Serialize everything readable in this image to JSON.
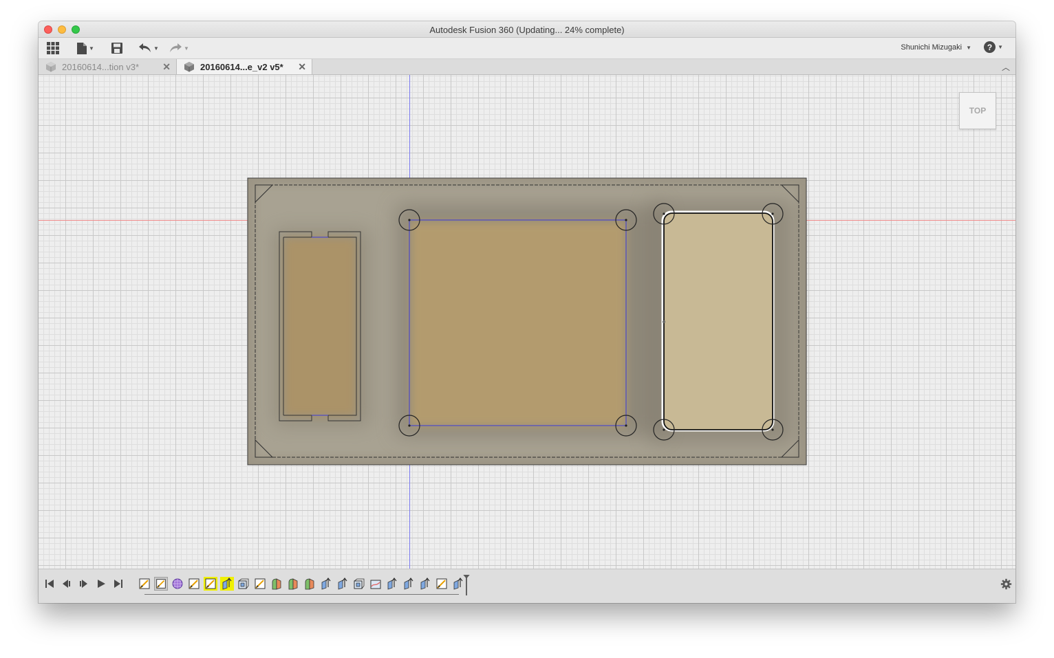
{
  "window": {
    "title": "Autodesk Fusion 360  (Updating... 24% complete)",
    "progress_percent": 24
  },
  "toolbar": {
    "icons": [
      "grid-apps-icon",
      "file-icon",
      "save-icon",
      "undo-icon",
      "redo-icon"
    ],
    "user_name": "Shunichi Mizugaki",
    "user_caret": "▼",
    "help_label": "?",
    "help_caret": "▼"
  },
  "tabs": [
    {
      "label": "20160614...tion v3*",
      "active": false,
      "close": "✕"
    },
    {
      "label": "20160614...e_v2 v5*",
      "active": true,
      "close": "✕"
    }
  ],
  "tabbar": {
    "collapse_glyph": "︿"
  },
  "viewport": {
    "viewcube_label": "TOP",
    "colors": {
      "grid_major": "#c8c8c8",
      "grid_minor": "#dedede",
      "axis_x": "#f08c8c",
      "axis_y": "#7b7bf0",
      "plate": "#9c9585",
      "pocket_center": "#b39b6e",
      "pocket_left": "#ab9368",
      "pocket_right": "#c8b995",
      "sketch_line": "#3a3ad8"
    }
  },
  "timeline": {
    "playback_icons": [
      "skip-to-start-icon",
      "step-back-icon",
      "step-forward-icon",
      "play-icon",
      "skip-to-end-icon"
    ],
    "features": [
      {
        "icon": "sketch-feature-icon",
        "state": "normal"
      },
      {
        "icon": "sketch-feature-icon",
        "state": "selected"
      },
      {
        "icon": "form-feature-icon",
        "state": "normal"
      },
      {
        "icon": "sketch-feature-icon",
        "state": "normal"
      },
      {
        "icon": "sketch-feature-icon",
        "state": "highlighted"
      },
      {
        "icon": "extrude-feature-icon",
        "state": "highlighted"
      },
      {
        "icon": "shell-feature-icon",
        "state": "normal"
      },
      {
        "icon": "sketch-feature-icon",
        "state": "normal"
      },
      {
        "icon": "fillet-feature-icon",
        "state": "normal"
      },
      {
        "icon": "fillet-feature-icon",
        "state": "normal"
      },
      {
        "icon": "fillet-feature-icon",
        "state": "normal"
      },
      {
        "icon": "extrude-feature-icon",
        "state": "normal"
      },
      {
        "icon": "extrude-feature-icon",
        "state": "normal"
      },
      {
        "icon": "shell-feature-icon",
        "state": "normal"
      },
      {
        "icon": "patch-feature-icon",
        "state": "normal"
      },
      {
        "icon": "extrude-feature-icon",
        "state": "normal"
      },
      {
        "icon": "extrude-feature-icon",
        "state": "normal"
      },
      {
        "icon": "extrude-feature-icon",
        "state": "normal"
      },
      {
        "icon": "sketch-feature-icon",
        "state": "normal"
      },
      {
        "icon": "extrude-feature-icon",
        "state": "normal"
      }
    ],
    "settings_icon": "gear-icon"
  }
}
